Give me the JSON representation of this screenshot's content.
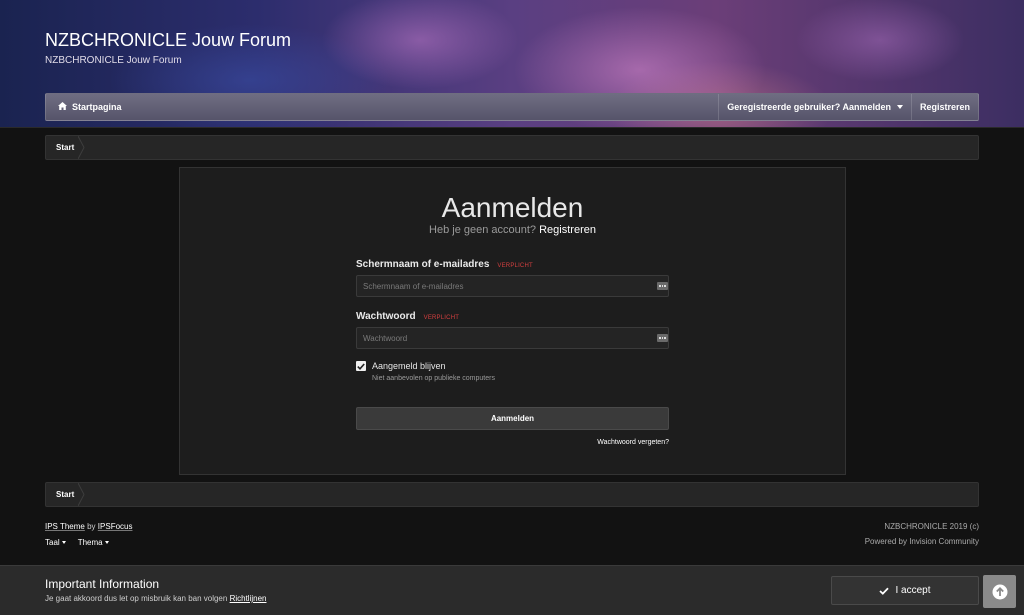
{
  "site": {
    "title": "NZBCHRONICLE Jouw Forum",
    "subtitle": "NZBCHRONICLE Jouw Forum"
  },
  "nav": {
    "home": "Startpagina",
    "login": "Geregistreerde gebruiker? Aanmelden",
    "register": "Registreren"
  },
  "breadcrumb": {
    "top": "Start",
    "bottom": "Start"
  },
  "login": {
    "heading": "Aanmelden",
    "no_account": "Heb je geen account?",
    "register_link": "Registreren",
    "username_label": "Schermnaam of e-mailadres",
    "username_placeholder": "Schermnaam of e-mailadres",
    "password_label": "Wachtwoord",
    "password_placeholder": "Wachtwoord",
    "required": "VERPLICHT",
    "remember_label": "Aangemeld blijven",
    "remember_checked": true,
    "remember_desc": "Niet aanbevolen op publieke computers",
    "submit": "Aanmelden",
    "forgot": "Wachtwoord vergeten?"
  },
  "footer": {
    "theme_prefix": "IPS Theme",
    "theme_by": "by",
    "theme_author": "IPSFocus",
    "language": "Taal",
    "theme": "Thema",
    "copyright": "NZBCHRONICLE 2019 (c)",
    "powered": "Powered by Invision Community"
  },
  "notice": {
    "title": "Important Information",
    "text": "Je gaat akkoord dus let op misbruik kan ban volgen",
    "link": "Richtlijnen",
    "accept": "I accept"
  },
  "icons": {
    "home": "home-icon",
    "check": "check-icon",
    "arrow_up": "arrow-up-circle-icon",
    "password_manager": "password-manager-icon"
  }
}
